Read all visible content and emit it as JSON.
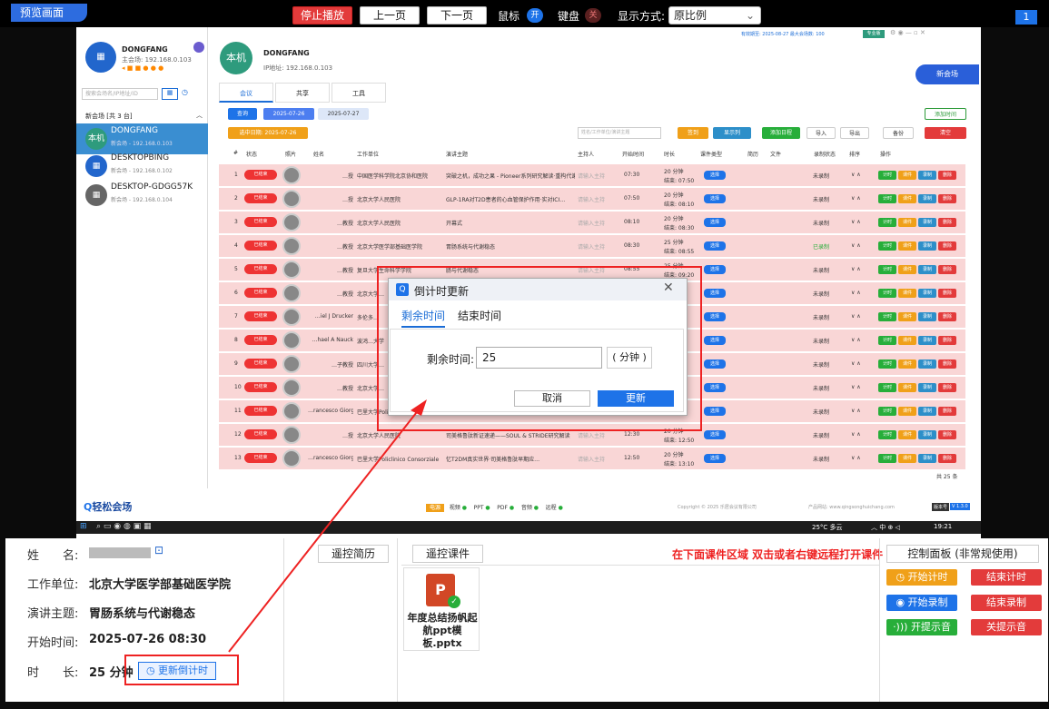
{
  "toolbar": {
    "preview": "预览画面",
    "stop": "停止播放",
    "prev": "上一页",
    "next": "下一页",
    "mouse": "鼠标",
    "mouse_state": "开",
    "keyboard": "键盘",
    "keyboard_state": "关",
    "display_label": "显示方式:",
    "display_value": "原比例",
    "screen_no": "1"
  },
  "remote": {
    "left": {
      "org": "DONGFANG",
      "ip": "主会场: 192.168.0.103",
      "search_placeholder": "搜索会场名/IP地址/ID",
      "group": "新会场",
      "group_count": "[共 3 台]",
      "devices": [
        {
          "avatar": "本机",
          "name": "DONGFANG",
          "ip": "新会场 - 192.168.0.103"
        },
        {
          "avatar": "",
          "name": "DESKTOPBING",
          "ip": "新会场 - 192.168.0.102"
        },
        {
          "avatar": "",
          "name": "DESKTOP-GDGG57K",
          "ip": "新会场 - 192.168.0.104"
        }
      ],
      "brand": "轻松会场"
    },
    "head": {
      "avatar": "本机",
      "name": "DONGFANG",
      "ip": "IP地址: 192.168.0.103",
      "info": "有效期至: 2025-08-27 最大会场数: 100",
      "badge": "专业版",
      "new_btn": "新会场"
    },
    "tabs": [
      "会议",
      "共享",
      "工具"
    ],
    "toolbar": {
      "query": "查询",
      "date1": "2025-07-26",
      "date2": "2025-07-27",
      "selected": "选中日期: 2025-07-26",
      "search_placeholder": "姓名/工作单位/演讲主题",
      "b1": "签到",
      "b2": "显示列",
      "b3": "添加日程",
      "b4": "导入",
      "b5": "导出",
      "b6": "备份",
      "b7": "清空",
      "add_btn": "添加时间"
    },
    "columns": [
      "#",
      "状态",
      "照片",
      "姓名",
      "工作单位",
      "演讲主题",
      "主持人",
      "开始时间",
      "时长",
      "课件类型",
      "简历",
      "文件",
      "录制状态",
      "排序",
      "操作"
    ],
    "rows": [
      {
        "n": "1",
        "status": "已结束",
        "name": "…授",
        "unit": "中国医学科学院北京协和医院",
        "topic": "突破之机，成功之果 - Pioneer系列研究解读·重构代谢治疗…",
        "host": "请输入主持",
        "start": "07:30",
        "dur": "20 分钟",
        "end": "结束: 07:50",
        "rec": "未录制"
      },
      {
        "n": "2",
        "status": "已结束",
        "name": "…授",
        "unit": "北京大学人民医院",
        "topic": "GLP-1RA对T2D患者的心血管保护作用·实对ICI…",
        "host": "请输入主持",
        "start": "07:50",
        "dur": "20 分钟",
        "end": "结束: 08:10",
        "rec": "未录制"
      },
      {
        "n": "3",
        "status": "已结束",
        "name": "…教授",
        "unit": "北京大学人民医院",
        "topic": "开幕式",
        "host": "请输入主持",
        "start": "08:10",
        "dur": "20 分钟",
        "end": "结束: 08:30",
        "rec": "未录制"
      },
      {
        "n": "4",
        "status": "已结束",
        "name": "…教授",
        "unit": "北京大学医学部基础医学院",
        "topic": "胃肠系统与代谢稳态",
        "host": "请输入主持",
        "start": "08:30",
        "dur": "25 分钟",
        "end": "结束: 08:55",
        "rec": "已录制"
      },
      {
        "n": "5",
        "status": "已结束",
        "name": "…教授",
        "unit": "复旦大学生命科学学院",
        "topic": "肠与代谢稳态",
        "host": "请输入主持",
        "start": "08:55",
        "dur": "25 分钟",
        "end": "结束: 09:20",
        "rec": "未录制"
      },
      {
        "n": "6",
        "status": "已结束",
        "name": "…教授",
        "unit": "北京大学…",
        "topic": "",
        "host": "",
        "start": "",
        "dur": "…15",
        "end": "",
        "rec": "未录制"
      },
      {
        "n": "7",
        "status": "已结束",
        "name": "…iel J Drucker",
        "unit": "多伦多…",
        "topic": "",
        "host": "",
        "start": "",
        "dur": "…",
        "end": "",
        "rec": "未录制"
      },
      {
        "n": "8",
        "status": "已结束",
        "name": "…hael A Nauck",
        "unit": "波鸿…大学",
        "topic": "",
        "host": "",
        "start": "",
        "dur": "…45",
        "end": "",
        "rec": "未录制"
      },
      {
        "n": "9",
        "status": "已结束",
        "name": "…子教授",
        "unit": "四川大学…",
        "topic": "",
        "host": "",
        "start": "",
        "dur": "",
        "end": "",
        "rec": "未录制"
      },
      {
        "n": "10",
        "status": "已结束",
        "name": "…教授",
        "unit": "北京大学…",
        "topic": "",
        "host": "",
        "start": "",
        "dur": "…35",
        "end": "",
        "rec": "未录制"
      },
      {
        "n": "11",
        "status": "已结束",
        "name": "…rancesco Giorgi",
        "unit": "巴里大学Poli…",
        "topic": "",
        "host": "",
        "start": "",
        "dur": "…15",
        "end": "",
        "rec": "未录制"
      },
      {
        "n": "12",
        "status": "已结束",
        "name": "…授",
        "unit": "北京大学人民医院",
        "topic": "司美格鲁肽新证速递——SOUL & STRIDE研究解读",
        "host": "请输入主持",
        "start": "12:30",
        "dur": "20 分钟",
        "end": "结束: 12:50",
        "rec": "未录制"
      },
      {
        "n": "13",
        "status": "已结束",
        "name": "…rancesco Giorgi",
        "unit": "巴里大学Policlinico Consorziale",
        "topic": "忆T2DM真实世界·司美格鲁肽早期应…",
        "host": "请输入主持",
        "start": "12:50",
        "dur": "20 分钟",
        "end": "结束: 13:10",
        "rec": "未录制"
      }
    ],
    "row_btn": "已结束",
    "row_blue": "选择",
    "row_ops": [
      "计时",
      "课件",
      "录制",
      "删除"
    ],
    "total": "共 25 条",
    "footer": {
      "copyright": "Copyright © 2025 乐居会议有限公司",
      "website": "产品网站: www.qingsonghuichang.com",
      "version": "版本号",
      "ver": "V 1.3.0"
    },
    "status_chips": [
      "电源",
      "视频",
      "PPT",
      "PDF",
      "音频",
      "远程"
    ],
    "taskbar": {
      "weather": "25°C 多云",
      "time": "19:21"
    }
  },
  "dialog": {
    "title": "倒计时更新",
    "tabs": [
      "剩余时间",
      "结束时间"
    ],
    "field_label": "剩余时间:",
    "field_value": "25",
    "unit": "( 分钟 )",
    "cancel": "取消",
    "update": "更新"
  },
  "bottom": {
    "labels": [
      "姓　　名:",
      "工作单位:",
      "演讲主题:",
      "开始时间:",
      "时　　长:"
    ],
    "unit": "北京大学医学部基础医学院",
    "topic": "胃肠系统与代谢稳态",
    "start": "2025-07-26 08:30",
    "duration": "25 分钟",
    "update_btn": "更新倒计时",
    "remote_cv": "遥控简历",
    "remote_slides": "遥控课件",
    "hint": "在下面课件区域 双击或者右键远程打开课件",
    "panel": "控制面板 (非常规使用)",
    "file_name": "年度总结扬帆起航ppt模板.pptx",
    "controls": [
      "开始计时",
      "结束计时",
      "开始录制",
      "结束录制",
      "开提示音",
      "关提示音"
    ]
  },
  "colors": {
    "accent": "#1e73e8",
    "red": "#e33b3b",
    "orange": "#f0a019",
    "green": "#27ae3a",
    "pink": "#f9d6d6"
  }
}
